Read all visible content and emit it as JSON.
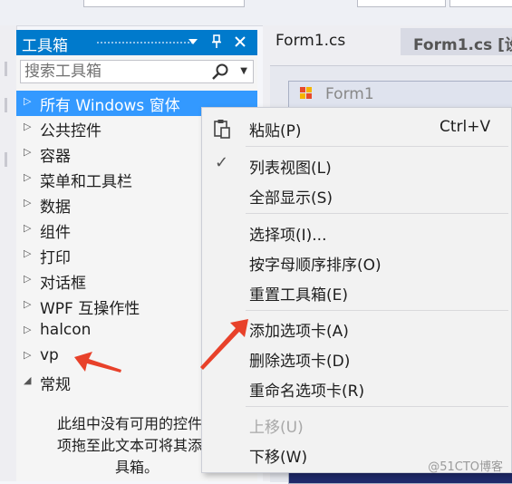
{
  "toolbox": {
    "title": "工具箱",
    "search_placeholder": "搜索工具箱",
    "header_icons": [
      "chevron-down-icon",
      "pin-icon",
      "close-icon"
    ],
    "categories": [
      {
        "label": "所有 Windows 窗体",
        "selected": true
      },
      {
        "label": "公共控件"
      },
      {
        "label": "容器"
      },
      {
        "label": "菜单和工具栏"
      },
      {
        "label": "数据"
      },
      {
        "label": "组件"
      },
      {
        "label": "打印"
      },
      {
        "label": "对话框"
      },
      {
        "label": "WPF 互操作性"
      },
      {
        "label": "halcon"
      },
      {
        "label": "vp"
      },
      {
        "label": "常规",
        "expanded": true
      }
    ],
    "empty_message": [
      "此组中没有可用的控件。",
      "项拖至此文本可将其添加",
      "具箱。"
    ]
  },
  "editor": {
    "tabs": [
      {
        "label": "Form1.cs",
        "active": false
      },
      {
        "label": "Form1.cs [设",
        "active": true
      }
    ],
    "form_title": "Form1"
  },
  "context_menu": {
    "items": [
      {
        "label": "粘贴(P)",
        "shortcut": "Ctrl+V",
        "icon": "paste-icon"
      },
      {
        "label": "列表视图(L)",
        "checked": true
      },
      {
        "label": "全部显示(S)"
      },
      {
        "label": "选择项(I)..."
      },
      {
        "label": "按字母顺序排序(O)"
      },
      {
        "label": "重置工具箱(E)"
      },
      {
        "label": "添加选项卡(A)"
      },
      {
        "label": "删除选项卡(D)"
      },
      {
        "label": "重命名选项卡(R)"
      },
      {
        "label": "上移(U)",
        "disabled": true
      },
      {
        "label": "下移(W)"
      }
    ]
  },
  "watermark": "@51CTO博客",
  "colors": {
    "accent": "#007acc",
    "selection": "#3399ff",
    "annotation_arrow": "#e8412a"
  }
}
